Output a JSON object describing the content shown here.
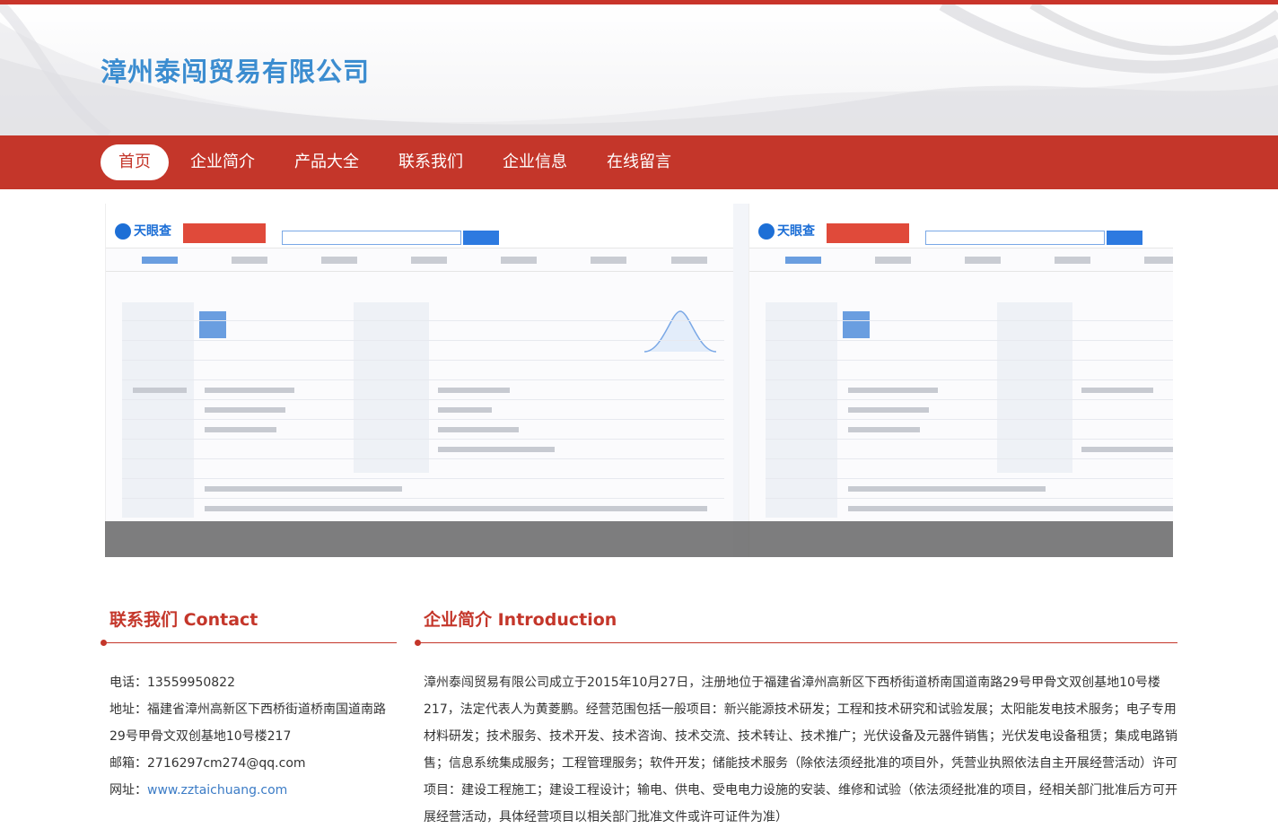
{
  "company_name": "漳州泰闯贸易有限公司",
  "nav": {
    "items": [
      {
        "label": "首页"
      },
      {
        "label": "企业简介"
      },
      {
        "label": "产品大全"
      },
      {
        "label": "联系我们"
      },
      {
        "label": "企业信息"
      },
      {
        "label": "在线留言"
      }
    ],
    "active_index": 0
  },
  "banner": {
    "slide_brand": "天眼查"
  },
  "contact": {
    "title": "联系我们 Contact",
    "phone_label": "电话：",
    "phone": "13559950822",
    "address_label": "地址：",
    "address": "福建省漳州高新区下西桥街道桥南国道南路29号甲骨文双创基地10号楼217",
    "email_label": "邮箱：",
    "email": "2716297cm274@qq.com",
    "website_label": "网址：",
    "website": "www.zztaichuang.com"
  },
  "intro": {
    "title": "企业简介 Introduction",
    "text": "漳州泰闯贸易有限公司成立于2015年10月27日，注册地位于福建省漳州高新区下西桥街道桥南国道南路29号甲骨文双创基地10号楼217，法定代表人为黄菱鹏。经营范围包括一般项目：新兴能源技术研发；工程和技术研究和试验发展；太阳能发电技术服务；电子专用材料研发；技术服务、技术开发、技术咨询、技术交流、技术转让、技术推广；光伏设备及元器件销售；光伏发电设备租赁；集成电路销售；信息系统集成服务；工程管理服务；软件开发；储能技术服务（除依法须经批准的项目外，凭营业执照依法自主开展经营活动）许可项目：建设工程施工；建设工程设计；输电、供电、受电电力设施的安装、维修和试验（依法须经批准的项目，经相关部门批准后方可开展经营活动，具体经营项目以相关部门批准文件或许可证件为准）"
  },
  "colors": {
    "brand_red": "#c4362a",
    "logo_blue": "#3c8dd0",
    "link_blue": "#3c7cc6"
  }
}
